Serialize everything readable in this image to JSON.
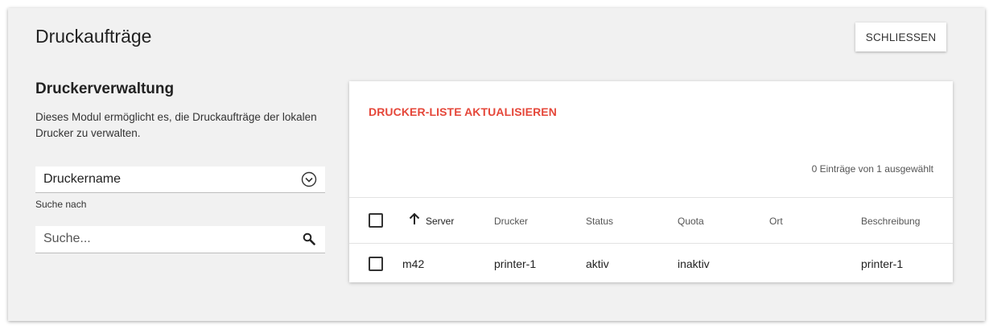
{
  "dialog": {
    "title": "Druckaufträge",
    "close_label": "SCHLIESSEN"
  },
  "sidebar": {
    "heading": "Druckerverwaltung",
    "description": "Dieses Modul ermöglicht es, die Druckaufträge der lokalen Drucker zu verwalten.",
    "select": {
      "value": "Druckername",
      "icon": "chevron-down-circle-icon"
    },
    "search_label": "Suche nach",
    "search": {
      "placeholder": "Suche...",
      "value": "",
      "icon": "search-icon"
    }
  },
  "grid": {
    "refresh_label": "DRUCKER-LISTE AKTUALISIEREN",
    "status_text": "0 Einträge von 1 ausgewählt",
    "accent_color": "#e5473a",
    "columns": [
      "Server",
      "Drucker",
      "Status",
      "Quota",
      "Ort",
      "Beschreibung"
    ],
    "sort_column": "Server",
    "sort_direction": "ascending",
    "rows": [
      {
        "checked": false,
        "server": "m42",
        "drucker": "printer-1",
        "status": "aktiv",
        "quota": "inaktiv",
        "ort": "",
        "beschreibung": "printer-1"
      }
    ]
  }
}
